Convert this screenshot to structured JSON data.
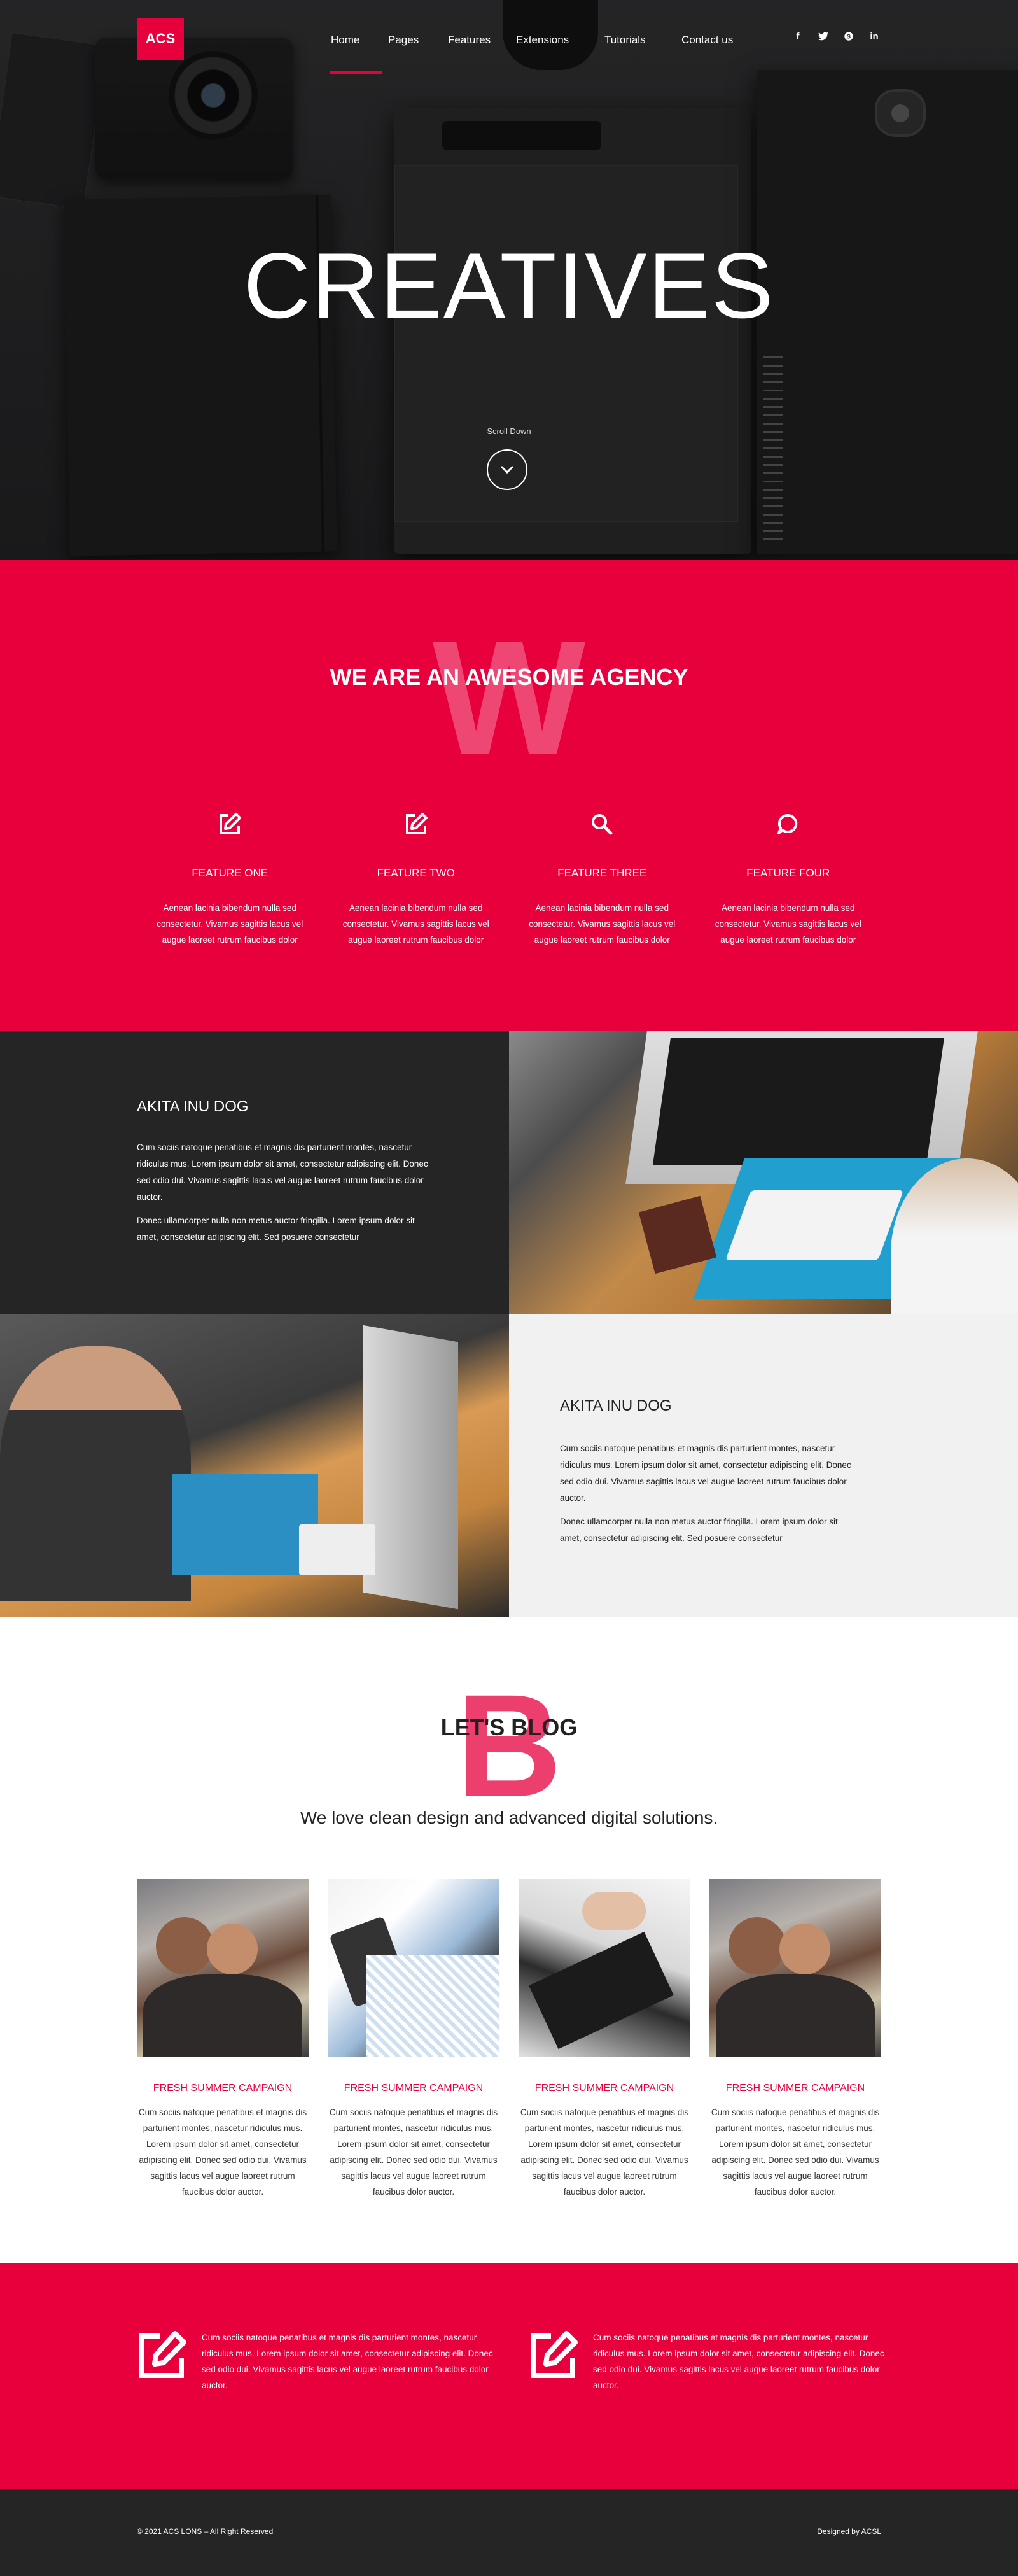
{
  "nav": {
    "logo": "ACS",
    "items": [
      "Home",
      "Pages",
      "Features",
      "Extensions",
      "Tutorials",
      "Contact us"
    ],
    "active": "Home",
    "social": [
      "facebook-icon",
      "twitter-icon",
      "skype-icon",
      "linkedin-icon"
    ],
    "social_glyphs": [
      "f",
      "t",
      "s",
      "in"
    ]
  },
  "hero": {
    "title": "CREATIVES",
    "scroll_label": "Scroll Down"
  },
  "agency": {
    "letter": "W",
    "heading": "WE ARE AN AWESOME AGENCY",
    "features": [
      {
        "icon": "edit-icon",
        "title": "FEATURE ONE",
        "text": "Aenean lacinia bibendum nulla sed consectetur. Vivamus sagittis lacus vel augue laoreet rutrum faucibus dolor"
      },
      {
        "icon": "edit-icon",
        "title": "FEATURE TWO",
        "text": "Aenean lacinia bibendum nulla sed consectetur. Vivamus sagittis lacus vel augue laoreet rutrum faucibus dolor"
      },
      {
        "icon": "search-icon",
        "title": "FEATURE THREE",
        "text": "Aenean lacinia bibendum nulla sed consectetur. Vivamus sagittis lacus vel augue laoreet rutrum faucibus dolor"
      },
      {
        "icon": "chat-icon",
        "title": "FEATURE FOUR",
        "text": "Aenean lacinia bibendum nulla sed consectetur. Vivamus sagittis lacus vel augue laoreet rutrum faucibus dolor"
      }
    ]
  },
  "about": [
    {
      "title": "AKITA INU DOG",
      "p1": "Cum sociis natoque penatibus et magnis dis parturient montes, nascetur ridiculus mus. Lorem ipsum dolor sit amet, consectetur adipiscing elit. Donec sed odio dui. Vivamus sagittis lacus vel augue laoreet rutrum faucibus dolor auctor.",
      "p2": "Donec ullamcorper nulla non metus auctor fringilla. Lorem ipsum dolor sit amet, consectetur adipiscing elit. Sed posuere consectetur"
    },
    {
      "title": "AKITA INU DOG",
      "p1": "Cum sociis natoque penatibus et magnis dis parturient montes, nascetur ridiculus mus. Lorem ipsum dolor sit amet, consectetur adipiscing elit. Donec sed odio dui. Vivamus sagittis lacus vel augue laoreet rutrum faucibus dolor auctor.",
      "p2": "Donec ullamcorper nulla non metus auctor fringilla. Lorem ipsum dolor sit amet, consectetur adipiscing elit. Sed posuere consectetur"
    }
  ],
  "blog": {
    "letter": "B",
    "heading": "LET'S BLOG",
    "subtitle": "We love clean design and advanced digital solutions.",
    "posts": [
      {
        "title": "FRESH SUMMER CAMPAIGN",
        "text": "Cum sociis natoque penatibus et magnis dis parturient montes, nascetur ridiculus mus. Lorem ipsum dolor sit amet, consectetur adipiscing elit. Donec sed odio dui. Vivamus sagittis lacus vel augue laoreet rutrum faucibus dolor auctor."
      },
      {
        "title": "FRESH SUMMER CAMPAIGN",
        "text": "Cum sociis natoque penatibus et magnis dis parturient montes, nascetur ridiculus mus. Lorem ipsum dolor sit amet, consectetur adipiscing elit. Donec sed odio dui. Vivamus sagittis lacus vel augue laoreet rutrum faucibus dolor auctor."
      },
      {
        "title": "FRESH SUMMER CAMPAIGN",
        "text": "Cum sociis natoque penatibus et magnis dis parturient montes, nascetur ridiculus mus. Lorem ipsum dolor sit amet, consectetur adipiscing elit. Donec sed odio dui. Vivamus sagittis lacus vel augue laoreet rutrum faucibus dolor auctor."
      },
      {
        "title": "FRESH SUMMER CAMPAIGN",
        "text": "Cum sociis natoque penatibus et magnis dis parturient montes, nascetur ridiculus mus. Lorem ipsum dolor sit amet, consectetur adipiscing elit. Donec sed odio dui. Vivamus sagittis lacus vel augue laoreet rutrum faucibus dolor auctor."
      }
    ]
  },
  "callout": {
    "items": [
      {
        "icon": "edit-icon",
        "text": "Cum sociis natoque penatibus et magnis dis parturient montes, nascetur ridiculus mus. Lorem ipsum dolor sit amet, consectetur adipiscing elit. Donec sed odio dui. Vivamus sagittis lacus vel augue laoreet rutrum faucibus dolor auctor."
      },
      {
        "icon": "edit-icon",
        "text": "Cum sociis natoque penatibus et magnis dis parturient montes, nascetur ridiculus mus. Lorem ipsum dolor sit amet, consectetur adipiscing elit. Donec sed odio dui. Vivamus sagittis lacus vel augue laoreet rutrum faucibus dolor auctor."
      }
    ]
  },
  "footer": {
    "copyright": "© 2021 ACS LONS – All Right Reserved",
    "designed_by": "Designed by ACSL"
  },
  "colors": {
    "accent": "#e8003d",
    "dark": "#252525",
    "light": "#f1f1f1"
  }
}
